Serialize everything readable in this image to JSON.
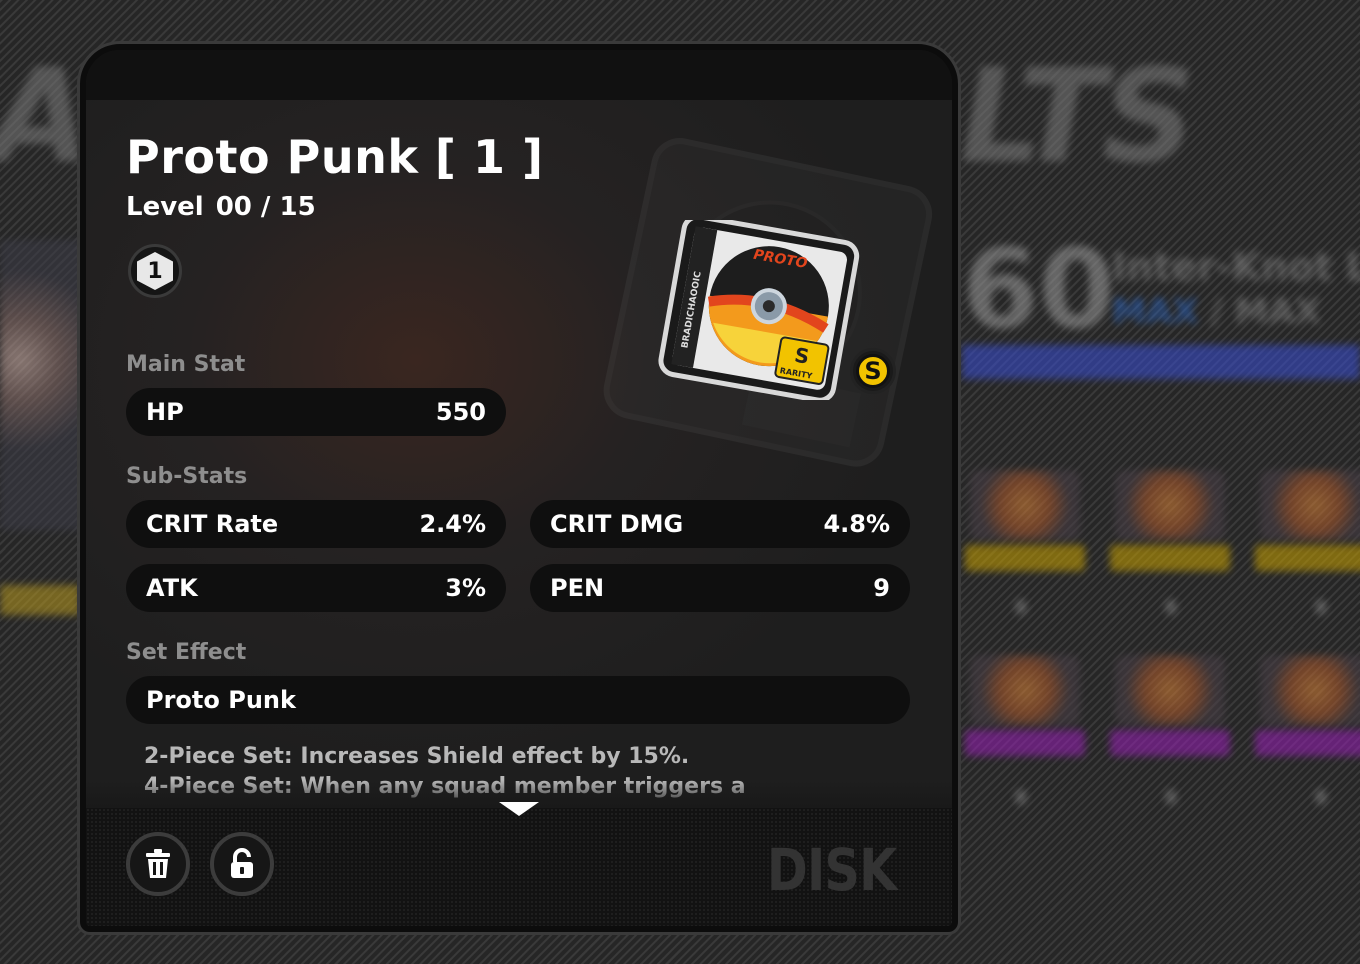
{
  "background": {
    "big_text_left": "A",
    "big_text_right": "LTS",
    "level_value": "60",
    "level_label": "Inter-Knot Le",
    "max_left": "MAX",
    "max_right": " / MAX"
  },
  "disk": {
    "title": "Proto Punk [ 1 ]",
    "level_label": "Level",
    "level_value": "00 / 15",
    "rank": "1",
    "rarity": "S",
    "art_brand": "PROTO",
    "art_rarity_label": "RARITY",
    "art_rarity_letter": "S",
    "art_side_text": "BRADICHAOOIC"
  },
  "main_stat": {
    "label": "Main Stat",
    "name": "HP",
    "value": "550"
  },
  "sub_stats": {
    "label": "Sub-Stats",
    "items": [
      {
        "name": "CRIT Rate",
        "value": "2.4%"
      },
      {
        "name": "CRIT DMG",
        "value": "4.8%"
      },
      {
        "name": "ATK",
        "value": "3%"
      },
      {
        "name": "PEN",
        "value": "9"
      }
    ]
  },
  "set_effect": {
    "label": "Set Effect",
    "name": "Proto Punk",
    "line1": "2-Piece Set: Increases Shield effect by 15%.",
    "line2": "4-Piece Set: When any squad member triggers a"
  },
  "footer": {
    "delete_icon": "trash-icon",
    "lock_icon": "unlock-icon",
    "tag": "DISK"
  },
  "colors": {
    "rarity_gold": "#f2c300",
    "panel_bg": "#1b1b1b",
    "stat_bg": "#0f0f0f",
    "accent_blue": "#3a4fd6"
  }
}
